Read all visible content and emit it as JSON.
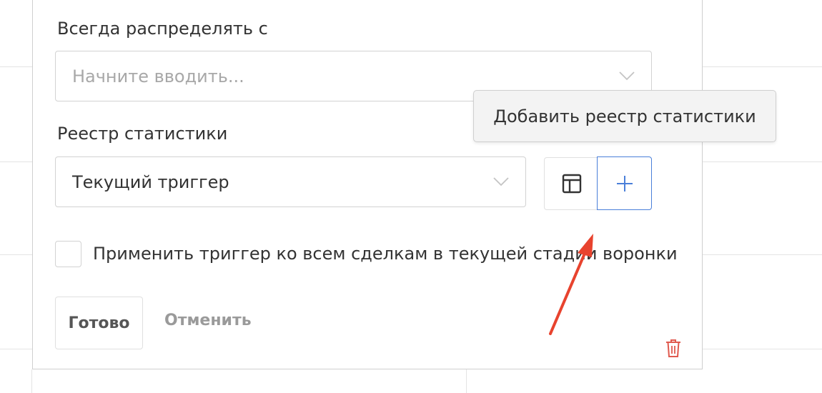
{
  "form": {
    "distribute_label": "Всегда распределять с",
    "distribute_placeholder": "Начните вводить...",
    "registry_label": "Реестр статистики",
    "registry_value": "Текущий триггер",
    "apply_all_label": "Применить триггер ко всем сделкам в текущей стадии воронки",
    "apply_all_checked": false
  },
  "tooltip": {
    "text": "Добавить реестр статистики"
  },
  "actions": {
    "done_label": "Готово",
    "cancel_label": "Отменить"
  },
  "icons": {
    "registry_table": "table-icon",
    "registry_add": "plus-icon",
    "delete": "trash-icon",
    "dropdown": "chevron-down-icon"
  },
  "colors": {
    "accent": "#4a7fd9",
    "delete": "#e05a4f",
    "annotation_arrow": "#e8432e"
  }
}
